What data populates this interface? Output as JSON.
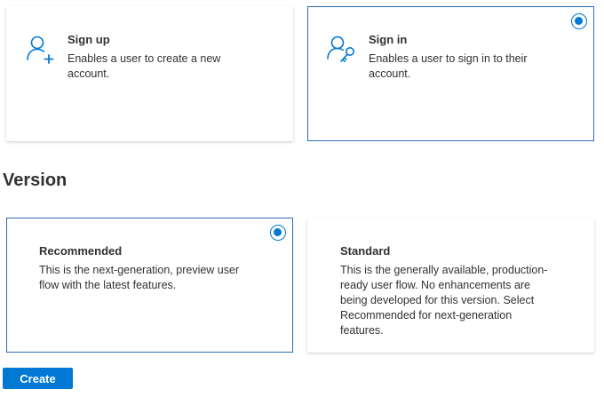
{
  "user_flow_types": [
    {
      "title": "Sign up",
      "description": "Enables a user to create a new account.",
      "icon": "user-add-icon",
      "selected": false
    },
    {
      "title": "Sign in",
      "description": "Enables a user to sign in to their account.",
      "icon": "user-key-icon",
      "selected": true
    }
  ],
  "version": {
    "heading": "Version",
    "options": [
      {
        "title": "Recommended",
        "description": "This is the next-generation, preview user flow with the latest features.",
        "selected": true
      },
      {
        "title": "Standard",
        "description": "This is the generally available, production-ready user flow. No enhancements are being developed for this version. Select Recommended for next-generation features.",
        "selected": false
      }
    ]
  },
  "actions": {
    "create_label": "Create"
  },
  "colors": {
    "accent": "#0078d4",
    "selected_border": "#2b6bb5",
    "text": "#323130"
  }
}
